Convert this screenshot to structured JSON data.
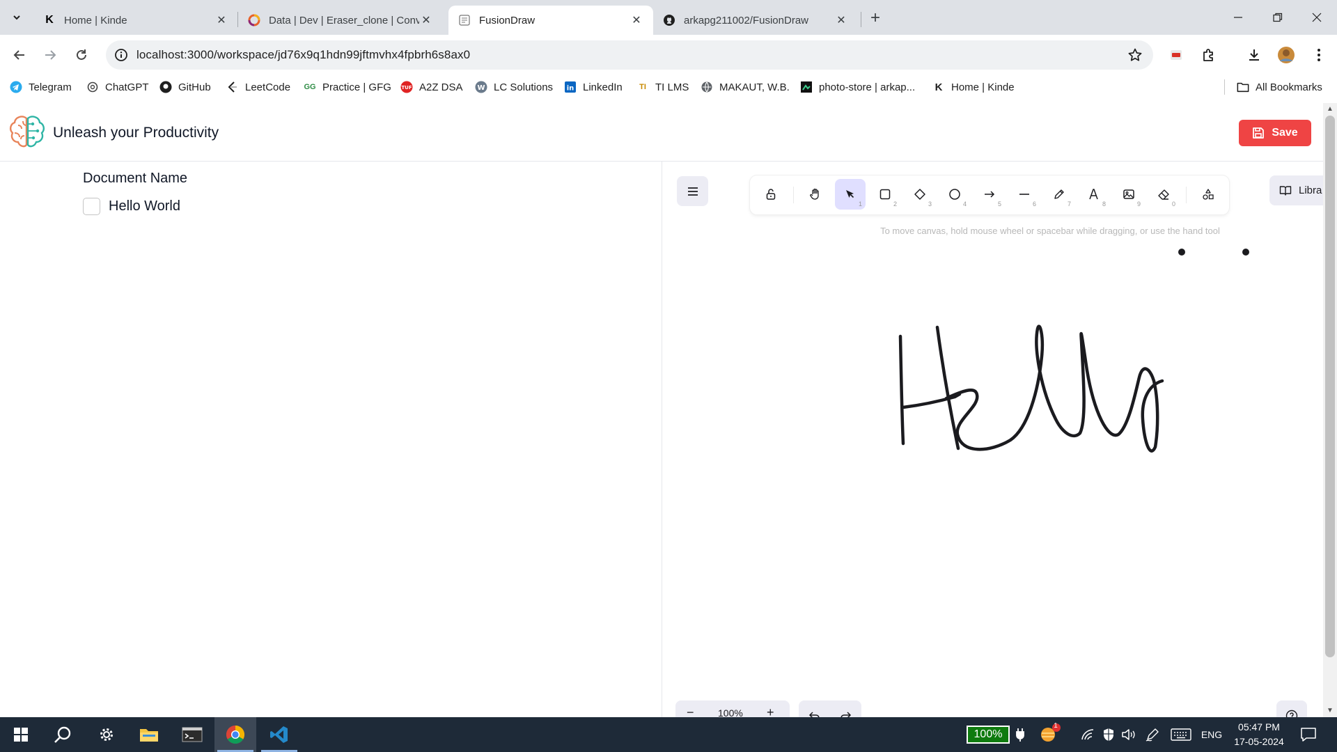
{
  "browser": {
    "tabs": [
      {
        "title": "Home | Kinde",
        "active": false
      },
      {
        "title": "Data | Dev | Eraser_clone | Conv",
        "active": false
      },
      {
        "title": "FusionDraw",
        "active": true
      },
      {
        "title": "arkapg211002/FusionDraw",
        "active": false
      }
    ],
    "url": "localhost:3000/workspace/jd76x9q1hdn99jftmvhx4fpbrh6s8ax0",
    "bookmarks": [
      {
        "label": "Telegram",
        "icon": "telegram-icon"
      },
      {
        "label": "ChatGPT",
        "icon": "chatgpt-icon"
      },
      {
        "label": "GitHub",
        "icon": "github-icon"
      },
      {
        "label": "LeetCode",
        "icon": "leetcode-icon"
      },
      {
        "label": "Practice | GFG",
        "icon": "gfg-icon"
      },
      {
        "label": "A2Z DSA",
        "icon": "tuf-icon"
      },
      {
        "label": "LC Solutions",
        "icon": "wp-icon"
      },
      {
        "label": "LinkedIn",
        "icon": "linkedin-icon"
      },
      {
        "label": "TI LMS",
        "icon": "ti-icon"
      },
      {
        "label": "MAKAUT, W.B.",
        "icon": "globe-icon"
      },
      {
        "label": "photo-store | arkap...",
        "icon": "photostore-icon"
      },
      {
        "label": "Home | Kinde",
        "icon": "kinde-icon"
      }
    ],
    "all_bookmarks": "All Bookmarks"
  },
  "app": {
    "title": "Unleash your Productivity",
    "save_label": "Save",
    "accent": "#ef4444"
  },
  "document": {
    "heading": "Document Name",
    "items": [
      {
        "text": "Hello World",
        "checked": false
      }
    ]
  },
  "canvas": {
    "tools": [
      {
        "name": "lock",
        "key": ""
      },
      {
        "name": "hand",
        "key": ""
      },
      {
        "name": "selection",
        "key": "1",
        "selected": true
      },
      {
        "name": "rectangle",
        "key": "2"
      },
      {
        "name": "diamond",
        "key": "3"
      },
      {
        "name": "ellipse",
        "key": "4"
      },
      {
        "name": "arrow",
        "key": "5"
      },
      {
        "name": "line",
        "key": "6"
      },
      {
        "name": "draw",
        "key": "7"
      },
      {
        "name": "text",
        "key": "8"
      },
      {
        "name": "image",
        "key": "9"
      },
      {
        "name": "eraser",
        "key": "0"
      },
      {
        "name": "extra-tools",
        "key": ""
      }
    ],
    "library_label": "Libra",
    "hint": "To move canvas, hold mouse wheel or spacebar while dragging, or use the hand tool",
    "zoom": "100%",
    "drawing_text": "Hello"
  },
  "taskbar": {
    "battery": "100%",
    "language": "ENG",
    "time": "05:47 PM",
    "date": "17-05-2024",
    "notification_badge": "1"
  }
}
